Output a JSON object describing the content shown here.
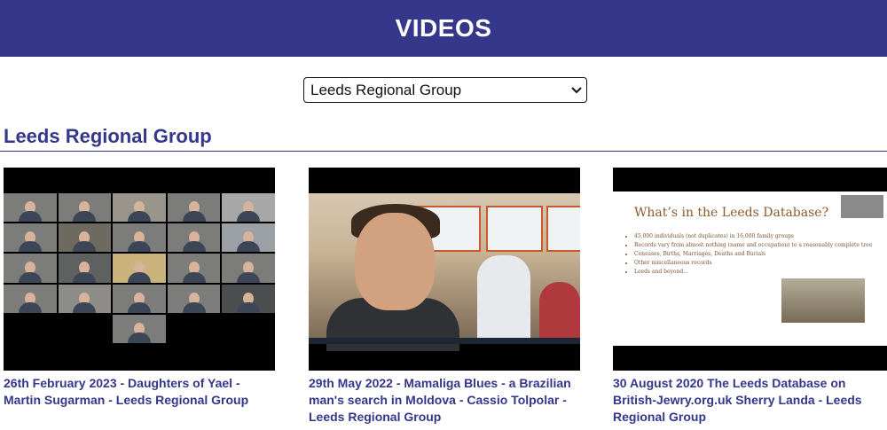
{
  "header": {
    "title": "VIDEOS"
  },
  "filter": {
    "selected": "Leeds Regional Group"
  },
  "section": {
    "title": "Leeds Regional Group"
  },
  "videos": [
    {
      "caption": "26th February 2023 - Daughters of Yael - Martin Sugarman - Leeds Regional Group"
    },
    {
      "caption": "29th May 2022 - Mamaliga Blues - a Brazilian man's search in Moldova - Cassio Tolpolar - Leeds Regional Group"
    },
    {
      "caption": "30 August 2020 The Leeds Database on British-Jewry.org.uk Sherry Landa - Leeds Regional Group",
      "slide": {
        "title": "What’s in the Leeds Database?",
        "bullets": [
          "45,000 individuals (not duplicates) in 16,000 family groups",
          "Records vary from almost nothing (name and occupation) to a reasonably complete tree",
          "Censuses, Births, Marriages, Deaths and Burials",
          "Other miscellaneous records",
          "Leeds and beyond..."
        ]
      }
    }
  ],
  "colors": {
    "brand": "#34378a",
    "background": "#ffffff"
  },
  "icons": {
    "dropdown": "chevron-down-icon"
  }
}
